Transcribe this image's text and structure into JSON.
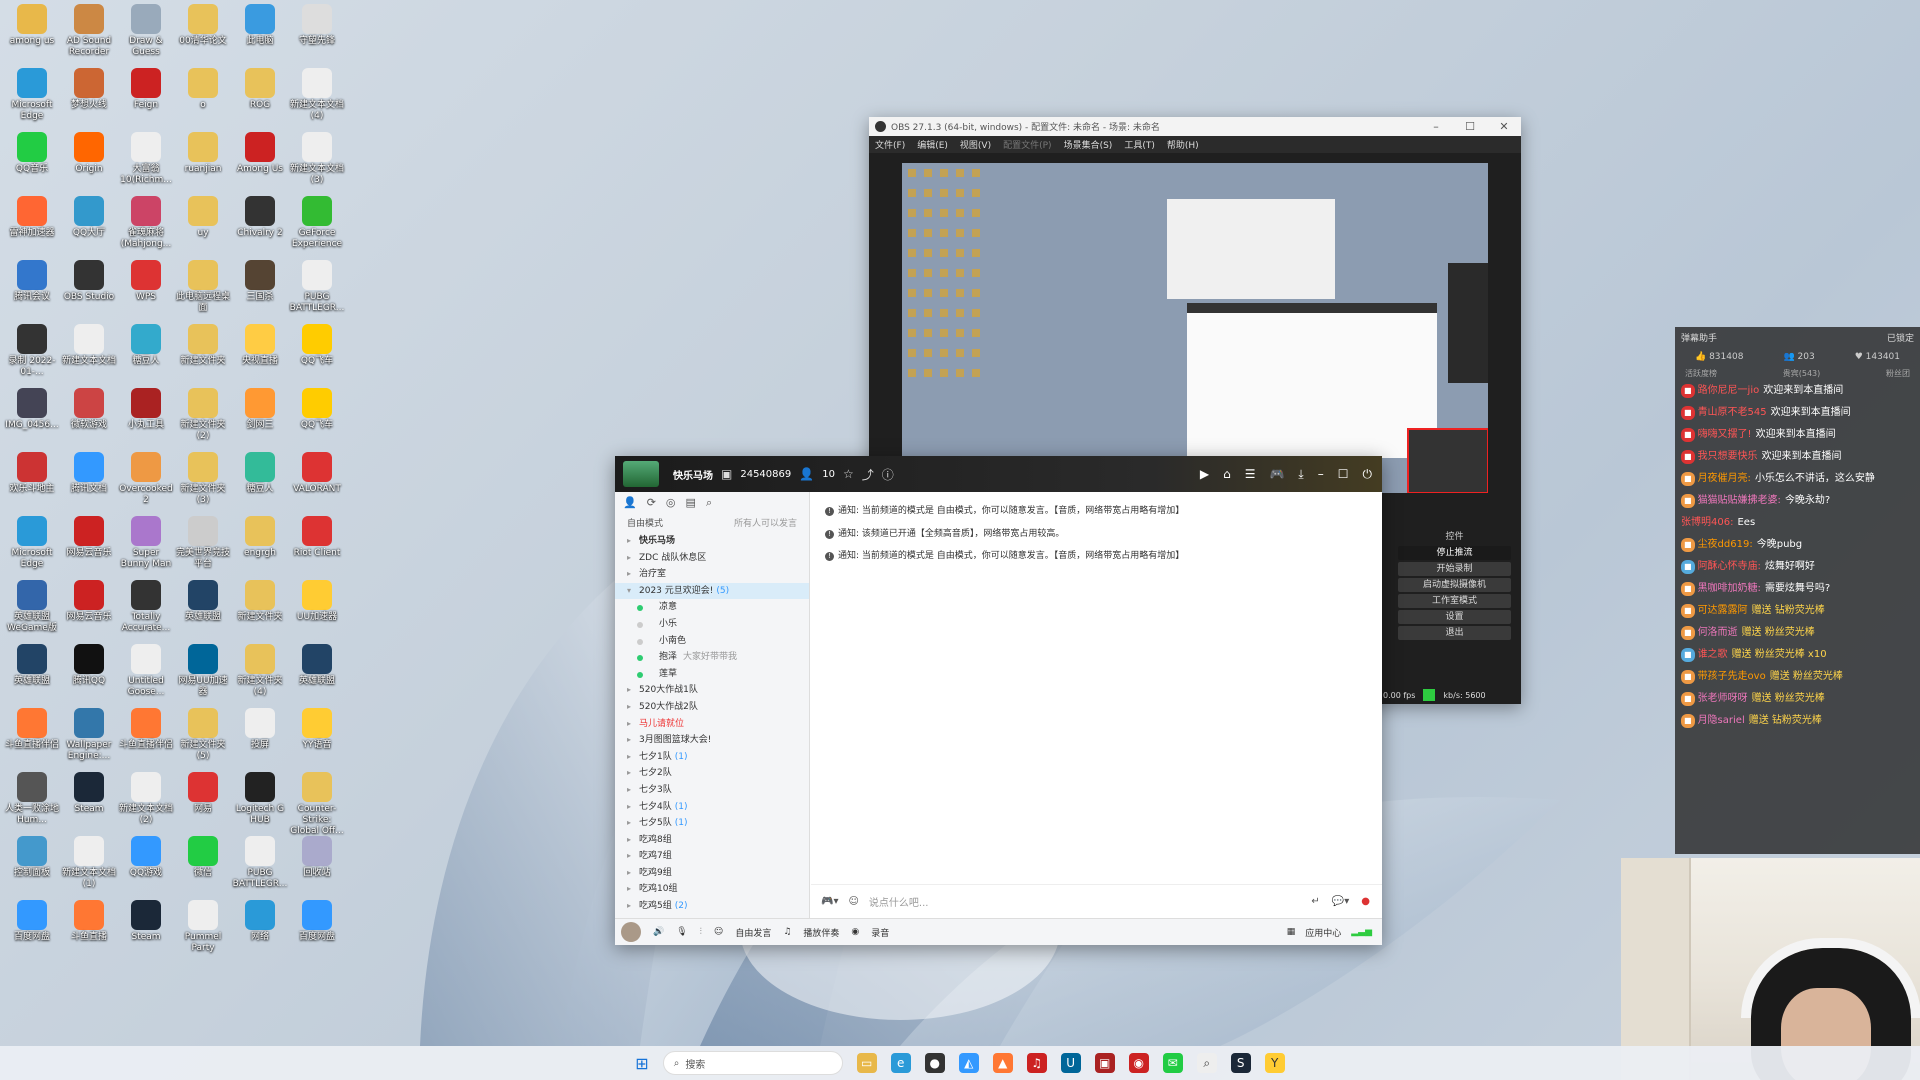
{
  "desktop_icons": [
    {
      "label": "among us",
      "color": "#e8b84a"
    },
    {
      "label": "AD Sound Recorder",
      "color": "#c84"
    },
    {
      "label": "Draw & Guess",
      "color": "#9ab"
    },
    {
      "label": "00清华论文",
      "color": "#e8c25a"
    },
    {
      "label": "此电脑",
      "color": "#3a9be0"
    },
    {
      "label": "守望先锋",
      "color": "#ddd"
    },
    {
      "label": "Microsoft Edge",
      "color": "#2a9ad8"
    },
    {
      "label": "梦想火线",
      "color": "#c63"
    },
    {
      "label": "Feign",
      "color": "#c22"
    },
    {
      "label": "o",
      "color": "#e8c25a"
    },
    {
      "label": "ROG",
      "color": "#e8c25a"
    },
    {
      "label": "新建文本文档 (4)",
      "color": "#eee"
    },
    {
      "label": "QQ音乐",
      "color": "#2c4"
    },
    {
      "label": "Origin",
      "color": "#f60"
    },
    {
      "label": "大富翁10(Richm...",
      "color": "#eee"
    },
    {
      "label": "ruanjian",
      "color": "#e8c25a"
    },
    {
      "label": "Among Us",
      "color": "#c22"
    },
    {
      "label": "新建文本文档 (3)",
      "color": "#eee"
    },
    {
      "label": "雷神加速器",
      "color": "#f63"
    },
    {
      "label": "QQ大厅",
      "color": "#39c"
    },
    {
      "label": "雀魂麻将(Mahjong...",
      "color": "#c46"
    },
    {
      "label": "uy",
      "color": "#e8c25a"
    },
    {
      "label": "Chivalry 2",
      "color": "#333"
    },
    {
      "label": "GeForce Experience",
      "color": "#3b3"
    },
    {
      "label": "腾讯会议",
      "color": "#37c"
    },
    {
      "label": "OBS Studio",
      "color": "#333"
    },
    {
      "label": "WPS",
      "color": "#d33"
    },
    {
      "label": "此电脑远程桌面",
      "color": "#e8c25a"
    },
    {
      "label": "三国杀",
      "color": "#543"
    },
    {
      "label": "PUBG BATTLEGR...",
      "color": "#eee"
    },
    {
      "label": "录制 2022-01-...",
      "color": "#333"
    },
    {
      "label": "新建文本文档",
      "color": "#eee"
    },
    {
      "label": "糖豆人",
      "color": "#3ac"
    },
    {
      "label": "新建文件夹",
      "color": "#e8c25a"
    },
    {
      "label": "央视直播",
      "color": "#fc4"
    },
    {
      "label": "QQ飞车",
      "color": "#fc0"
    },
    {
      "label": "IMG_0456...",
      "color": "#445"
    },
    {
      "label": "微软游戏",
      "color": "#c44"
    },
    {
      "label": "小丸工具",
      "color": "#a22"
    },
    {
      "label": "新建文件夹 (2)",
      "color": "#e8c25a"
    },
    {
      "label": "剑网三",
      "color": "#f93"
    },
    {
      "label": "QQ飞车",
      "color": "#fc0"
    },
    {
      "label": "欢乐斗地主",
      "color": "#c33"
    },
    {
      "label": "腾讯文档",
      "color": "#39f"
    },
    {
      "label": "Overcooked 2",
      "color": "#e94"
    },
    {
      "label": "新建文件夹 (3)",
      "color": "#e8c25a"
    },
    {
      "label": "糖豆人",
      "color": "#3b9"
    },
    {
      "label": "VALORANT",
      "color": "#d33"
    },
    {
      "label": "Microsoft Edge",
      "color": "#2a9ad8"
    },
    {
      "label": "网易云音乐",
      "color": "#c22"
    },
    {
      "label": "Super Bunny Man",
      "color": "#a7c"
    },
    {
      "label": "完美世界竞技平台",
      "color": "#ccc"
    },
    {
      "label": "engrgh",
      "color": "#e8c25a"
    },
    {
      "label": "Riot Client",
      "color": "#d33"
    },
    {
      "label": "英雄联盟 WeGame版",
      "color": "#36a"
    },
    {
      "label": "网易云音乐",
      "color": "#c22"
    },
    {
      "label": "Totally Accurate...",
      "color": "#333"
    },
    {
      "label": "英雄联盟",
      "color": "#246"
    },
    {
      "label": "新建文件夹",
      "color": "#e8c25a"
    },
    {
      "label": "UU加速器",
      "color": "#fc3"
    },
    {
      "label": "英雄联盟",
      "color": "#246"
    },
    {
      "label": "腾讯QQ",
      "color": "#111"
    },
    {
      "label": "Untitled Goose...",
      "color": "#eee"
    },
    {
      "label": "网易UU加速器",
      "color": "#069"
    },
    {
      "label": "新建文件夹 (4)",
      "color": "#e8c25a"
    },
    {
      "label": "英雄联盟",
      "color": "#246"
    },
    {
      "label": "斗鱼直播伴侣",
      "color": "#f73"
    },
    {
      "label": "Wallpaper Engine:...",
      "color": "#37a"
    },
    {
      "label": "斗鱼直播伴侣",
      "color": "#f73"
    },
    {
      "label": "新建文件夹 (5)",
      "color": "#e8c25a"
    },
    {
      "label": "投屏",
      "color": "#eee"
    },
    {
      "label": "YY语音",
      "color": "#fc3"
    },
    {
      "label": "人类一败涂地 Hum...",
      "color": "#555"
    },
    {
      "label": "Steam",
      "color": "#1b2838"
    },
    {
      "label": "新建文本文档 (2)",
      "color": "#eee"
    },
    {
      "label": "网易",
      "color": "#d33"
    },
    {
      "label": "Logitech G HUB",
      "color": "#222"
    },
    {
      "label": "Counter-Strike: Global Off...",
      "color": "#e8c25a"
    },
    {
      "label": "控制面板",
      "color": "#49c"
    },
    {
      "label": "新建文本文档 (1)",
      "color": "#eee"
    },
    {
      "label": "QQ游戏",
      "color": "#39f"
    },
    {
      "label": "微信",
      "color": "#2c4"
    },
    {
      "label": "PUBG BATTLEGR...",
      "color": "#eee"
    },
    {
      "label": "回收站",
      "color": "#aac"
    },
    {
      "label": "百度网盘",
      "color": "#39f"
    },
    {
      "label": "斗鱼直播",
      "color": "#f73"
    },
    {
      "label": "Steam",
      "color": "#1b2838"
    },
    {
      "label": "Pummel Party",
      "color": "#eee"
    },
    {
      "label": "网络",
      "color": "#2a9ad8"
    },
    {
      "label": "百度网盘",
      "color": "#39f"
    }
  ],
  "obs": {
    "title": "OBS 27.1.3 (64-bit, windows) - 配置文件: 未命名 - 场景: 未命名",
    "menu": [
      "文件(F)",
      "编辑(E)",
      "视图(V)",
      "配置文件(P)",
      "场景集合(S)",
      "工具(T)",
      "帮助(H)"
    ],
    "controls_title": "控件",
    "controls": [
      "停止推流",
      "开始录制",
      "启动虚拟摄像机",
      "工作室模式",
      "设置",
      "退出"
    ],
    "status_fps": "0.00 fps",
    "status_kbps": "kb/s: 5600"
  },
  "yy": {
    "channel_name": "快乐马场",
    "channel_id": "24540869",
    "online_count": "10",
    "mode_label": "自由模式",
    "mode_right": "所有人可以发言",
    "tree": [
      {
        "label": "快乐马场",
        "kind": "lv0"
      },
      {
        "label": "ZDC 战队休息区",
        "kind": "lv1"
      },
      {
        "label": "治疗室",
        "kind": "lv1"
      },
      {
        "label": "2023 元旦欢迎会!",
        "count": "(5)",
        "kind": "sel"
      },
      {
        "label": "凉意",
        "kind": "sub"
      },
      {
        "label": "小乐",
        "kind": "sub"
      },
      {
        "label": "小南色",
        "kind": "sub"
      },
      {
        "label": "抱泽",
        "extra": "大家好带带我",
        "kind": "sub"
      },
      {
        "label": "莲草",
        "kind": "sub"
      },
      {
        "label": "520大作战1队",
        "kind": "lv1"
      },
      {
        "label": "520大作战2队",
        "kind": "lv1"
      },
      {
        "label": "马儿请就位",
        "kind": "red"
      },
      {
        "label": "3月图图篮球大会!",
        "kind": "lv1"
      },
      {
        "label": "七夕1队",
        "count": "(1)",
        "kind": "lv1"
      },
      {
        "label": "七夕2队",
        "kind": "lv1"
      },
      {
        "label": "七夕3队",
        "kind": "lv1"
      },
      {
        "label": "七夕4队",
        "count": "(1)",
        "kind": "lv1"
      },
      {
        "label": "七夕5队",
        "count": "(1)",
        "kind": "lv1"
      },
      {
        "label": "吃鸡8组",
        "kind": "lv1"
      },
      {
        "label": "吃鸡7组",
        "kind": "lv1"
      },
      {
        "label": "吃鸡9组",
        "kind": "lv1"
      },
      {
        "label": "吃鸡10组",
        "kind": "lv1"
      },
      {
        "label": "吃鸡5组",
        "count": "(2)",
        "kind": "lv1"
      }
    ],
    "notices": [
      "通知: 当前频道的模式是 自由模式，你可以随意发言。【音质，网络带宽占用略有增加】",
      "通知: 该频道已开通【全频高音质】，网络带宽占用较高。",
      "通知: 当前频道的模式是 自由模式，你可以随意发言。【音质，网络带宽占用略有增加】"
    ],
    "input_placeholder": "说点什么吧...",
    "bottom": {
      "free_speak": "自由发言",
      "music": "播放伴奏",
      "record": "录音",
      "apps": "应用中心"
    }
  },
  "danmaku": {
    "title": "弹幕助手",
    "locked": "已锁定",
    "stats": [
      "831408",
      "203",
      "143401"
    ],
    "tabs": [
      "活跃度榜",
      "贵宾(543)",
      "粉丝团"
    ],
    "messages": [
      {
        "user": "路你尼尼一jio",
        "text": "欢迎来到本直播间",
        "tag": "r"
      },
      {
        "user": "青山原不老545",
        "text": "欢迎来到本直播间",
        "tag": "r"
      },
      {
        "user": "嗨嗨又摆了!",
        "text": "欢迎来到本直播间",
        "tag": "r"
      },
      {
        "user": "我只想要快乐",
        "text": "欢迎来到本直播间",
        "tag": "r"
      },
      {
        "user": "月夜催月亮:",
        "text": "小乐怎么不讲话，这么安静",
        "tag": "o"
      },
      {
        "user": "猫猫贴贴嫌拂老婆:",
        "text": "今晚永劫?",
        "tag": "p"
      },
      {
        "user": "张博明406:",
        "text": "Ees",
        "tag": ""
      },
      {
        "user": "尘夜dd619:",
        "text": "今晚pubg",
        "tag": "o"
      },
      {
        "user": "阿酥心怀寺庙:",
        "text": "炫舞好啊好",
        "tag": "b"
      },
      {
        "user": "黑咖啡加奶糖:",
        "text": "需要炫舞号吗?",
        "tag": "p"
      },
      {
        "user": "可达露露阿",
        "text": "赠送 钻粉荧光棒",
        "tag": "o"
      },
      {
        "user": "何洛而逝",
        "text": "赠送 粉丝荧光棒",
        "tag": "p"
      },
      {
        "user": "谁之歌",
        "text": "赠送 粉丝荧光棒 x10",
        "tag": "b"
      },
      {
        "user": "带孩子先走ovo",
        "text": "赠送 粉丝荧光棒",
        "tag": "o"
      },
      {
        "user": "张老师呀呀",
        "text": "赠送 粉丝荧光棒",
        "tag": "p"
      },
      {
        "user": "月隐sariel",
        "text": "赠送 钻粉荧光棒",
        "tag": "p"
      }
    ]
  },
  "taskbar": {
    "search_placeholder": "搜索"
  }
}
